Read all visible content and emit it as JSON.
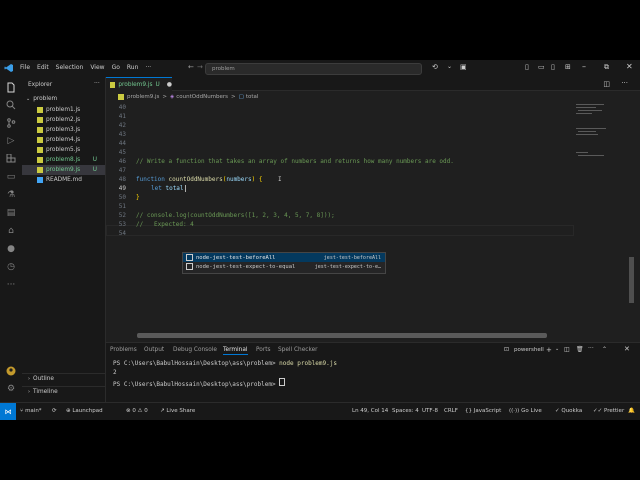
{
  "menu": [
    "File",
    "Edit",
    "Selection",
    "View",
    "Go",
    "Run"
  ],
  "search": {
    "text": "problem"
  },
  "sidebar": {
    "title": "Explorer",
    "folder": "problem",
    "files": [
      {
        "name": "problem1.js",
        "badge": ""
      },
      {
        "name": "problem2.js",
        "badge": ""
      },
      {
        "name": "problem3.js",
        "badge": ""
      },
      {
        "name": "problem4.js",
        "badge": ""
      },
      {
        "name": "problem5.js",
        "badge": ""
      },
      {
        "name": "problem8.js",
        "badge": "U"
      },
      {
        "name": "problem9.js",
        "badge": "U"
      },
      {
        "name": "README.md",
        "badge": ""
      }
    ],
    "outline": "Outline",
    "timeline": "Timeline"
  },
  "tab": {
    "label": "problem9.js",
    "badge": "U"
  },
  "breadcrumb": {
    "file": "problem9.js",
    "fn": "countOddNumbers",
    "var": "total",
    "sep": ">"
  },
  "editor": {
    "lines": [
      {
        "n": "40",
        "text": ""
      },
      {
        "n": "41",
        "text": ""
      },
      {
        "n": "42",
        "text": ""
      },
      {
        "n": "43",
        "text": ""
      },
      {
        "n": "44",
        "text": ""
      },
      {
        "n": "45",
        "text": ""
      },
      {
        "n": "46",
        "text": "// Write a function that takes an array of numbers and returns how many numbers are odd."
      },
      {
        "n": "47",
        "text": ""
      },
      {
        "n": "48",
        "text": ""
      },
      {
        "n": "49",
        "text": ""
      },
      {
        "n": "50",
        "text": "}"
      },
      {
        "n": "51",
        "text": ""
      },
      {
        "n": "52",
        "text": ""
      },
      {
        "n": "53",
        "text": "// console.log(countOddNumbers([1, 2, 3, 4, 5, 7, 8]));"
      },
      {
        "n": "54",
        "text": "//   Expected: 4"
      }
    ],
    "kw_function": "function",
    "fn_name": "countOddNumbers",
    "param": "numbers",
    "kw_let": "let",
    "var_total": "total"
  },
  "suggest": [
    {
      "label": "node-jest-test-beforeAll",
      "detail": "jest-test-beforeAll"
    },
    {
      "label": "node-jest-test-expect-to-equal",
      "detail": "jest-test-expect-to-e…"
    }
  ],
  "panel": {
    "tabs": [
      "Problems",
      "Output",
      "Debug Console",
      "Terminal",
      "Ports",
      "Spell Checker"
    ],
    "active": "Terminal",
    "shell": "powershell",
    "prompt1": "PS C:\\Users\\BabulHossain\\Desktop\\ass\\problem> ",
    "cmd1": "node problem9.js",
    "output": "2",
    "prompt2": "PS C:\\Users\\BabulHossain\\Desktop\\ass\\problem> "
  },
  "status": {
    "branch": "main*",
    "launchpad": "Launchpad",
    "errors": "0",
    "warnings": "0",
    "liveshare": "Live Share",
    "position": "Ln 49, Col 14",
    "spaces": "Spaces: 4",
    "encoding": "UTF-8",
    "eol": "CRLF",
    "language": "JavaScript",
    "golive": "Go Live",
    "quokka": "Quokka",
    "prettier": "Prettier"
  },
  "colors": {
    "accent": "#0078d4",
    "comment": "#6a9955",
    "keyword": "#569cd6",
    "function": "#dcdcaa",
    "parameter": "#9cdcfe",
    "untracked": "#73c991"
  }
}
